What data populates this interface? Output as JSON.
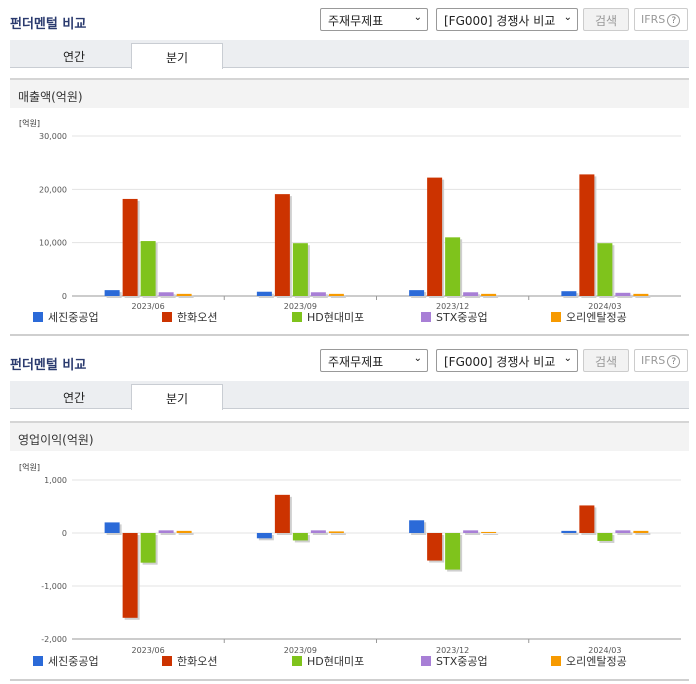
{
  "sections": [
    {
      "title": "펀더멘털 비교",
      "select_1": "주재무제표",
      "select_2": "[FG000] 경쟁사 비교",
      "search_label": "검색",
      "ifrs_label": "IFRS",
      "ifrs_help": "?",
      "tabs": [
        "연간",
        "분기"
      ],
      "active_tab": "분기",
      "metric_label": "매출액(억원)"
    },
    {
      "title": "펀더멘털 비교",
      "select_1": "주재무제표",
      "select_2": "[FG000] 경쟁사 비교",
      "search_label": "검색",
      "ifrs_label": "IFRS",
      "ifrs_help": "?",
      "tabs": [
        "연간",
        "분기"
      ],
      "active_tab": "분기",
      "metric_label": "영업이익(억원)"
    }
  ],
  "colors": {
    "세진중공업": "#2b6ad8",
    "한화오션": "#cc3300",
    "HD현대미포": "#7fc31c",
    "STX중공업": "#a87fd6",
    "오리엔탈정공": "#f79a00"
  },
  "chart_data": [
    {
      "type": "bar",
      "unit_label": "[억원]",
      "categories": [
        "2023/06",
        "2023/09",
        "2023/12",
        "2024/03"
      ],
      "ylim": [
        0,
        30000
      ],
      "yticks": [
        0,
        10000,
        20000,
        30000
      ],
      "ytick_labels": [
        "0",
        "10,000",
        "20,000",
        "30,000"
      ],
      "grid": true,
      "legend_position": "bottom",
      "series": [
        {
          "name": "세진중공업",
          "values": [
            1100,
            800,
            1100,
            900
          ]
        },
        {
          "name": "한화오션",
          "values": [
            18200,
            19100,
            22200,
            22800
          ]
        },
        {
          "name": "HD현대미포",
          "values": [
            10300,
            9900,
            11000,
            9900
          ]
        },
        {
          "name": "STX중공업",
          "values": [
            700,
            700,
            700,
            600
          ]
        },
        {
          "name": "오리엔탈정공",
          "values": [
            400,
            400,
            400,
            400
          ]
        }
      ]
    },
    {
      "type": "bar",
      "unit_label": "[억원]",
      "categories": [
        "2023/06",
        "2023/09",
        "2023/12",
        "2024/03"
      ],
      "ylim": [
        -2000,
        1000
      ],
      "yticks": [
        -2000,
        -1000,
        0,
        1000
      ],
      "ytick_labels": [
        "-2,000",
        "-1,000",
        "0",
        "1,000"
      ],
      "grid": true,
      "legend_position": "bottom",
      "series": [
        {
          "name": "세진중공업",
          "values": [
            200,
            -100,
            240,
            40
          ]
        },
        {
          "name": "한화오션",
          "values": [
            -1600,
            720,
            -520,
            520
          ]
        },
        {
          "name": "HD현대미포",
          "values": [
            -560,
            -140,
            -690,
            -150
          ]
        },
        {
          "name": "STX중공업",
          "values": [
            50,
            50,
            50,
            50
          ]
        },
        {
          "name": "오리엔탈정공",
          "values": [
            40,
            30,
            20,
            40
          ]
        }
      ]
    }
  ]
}
